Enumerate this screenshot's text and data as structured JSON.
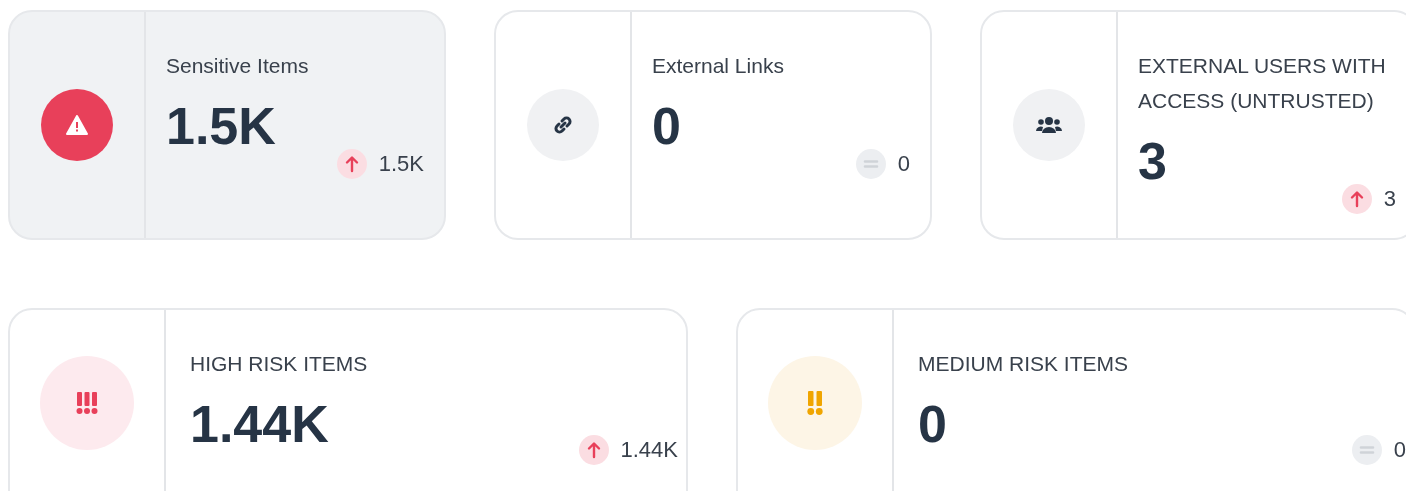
{
  "rows": [
    {
      "cards": [
        {
          "title": "Sensitive Items",
          "value": "1.5K",
          "kind": "warning",
          "selected": true,
          "trend": {
            "kind": "up",
            "value": "1.5K"
          }
        },
        {
          "title": "External Links",
          "value": "0",
          "kind": "link",
          "selected": false,
          "trend": {
            "kind": "flat",
            "value": "0"
          }
        },
        {
          "title": "EXTERNAL USERS WITH ACCESS (UNTRUSTED)",
          "value": "3",
          "kind": "users",
          "selected": false,
          "trend": {
            "kind": "up",
            "value": "3"
          }
        }
      ]
    },
    {
      "cards": [
        {
          "title": "HIGH RISK ITEMS",
          "value": "1.44K",
          "kind": "high",
          "selected": false,
          "trend": {
            "kind": "up",
            "value": "1.44K"
          }
        },
        {
          "title": "MEDIUM RISK ITEMS",
          "value": "0",
          "kind": "medium",
          "selected": false,
          "trend": {
            "kind": "flat",
            "value": "0"
          }
        }
      ]
    }
  ]
}
